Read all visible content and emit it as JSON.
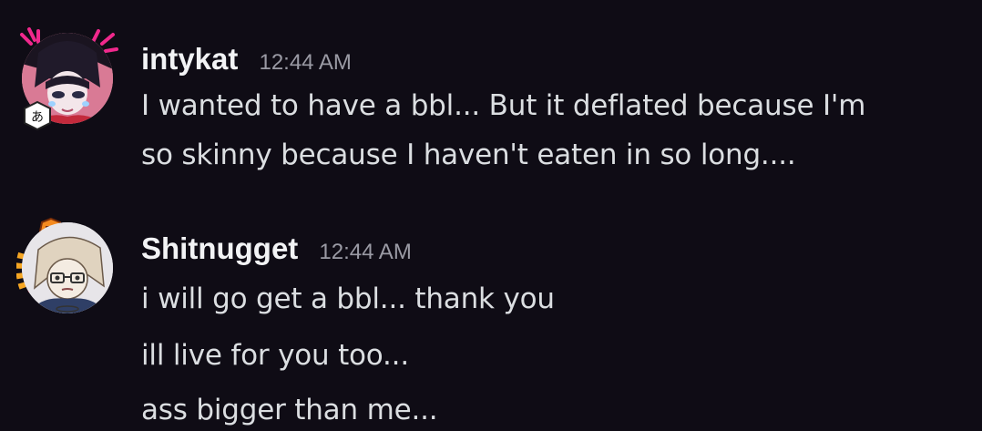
{
  "messages": [
    {
      "username": "intykat",
      "timestamp": "12:44 AM",
      "avatar_icon": "anime-character-avatar-icon",
      "lines": [
        "I wanted to have a bbl... But it deflated because I'm",
        "so skinny because I haven't eaten in so long...."
      ]
    },
    {
      "username": "Shitnugget",
      "timestamp": "12:44 AM",
      "avatar_icon": "anime-character-avatar-icon",
      "lines": [
        "i will go get a bbl... thank you",
        "ill live for you too...",
        "ass bigger than me..."
      ]
    }
  ]
}
